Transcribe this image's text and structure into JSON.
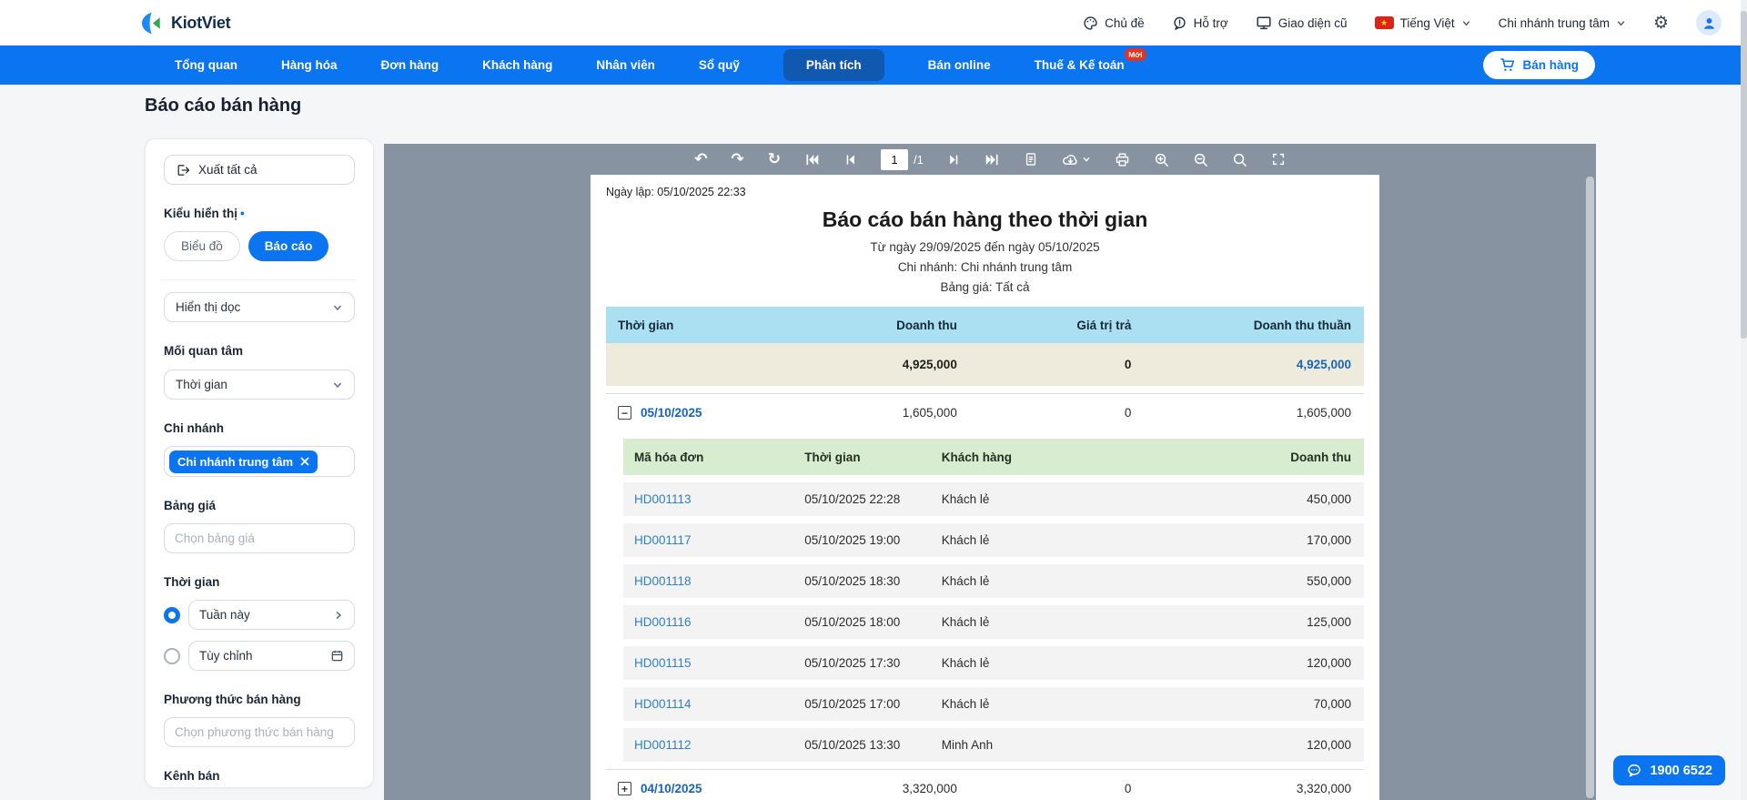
{
  "header": {
    "brand": "KiotViet",
    "theme": "Chủ đề",
    "support": "Hỗ trợ",
    "old_ui": "Giao diện cũ",
    "language": "Tiếng Việt",
    "branch": "Chi nhánh trung tâm"
  },
  "nav": {
    "items": [
      {
        "label": "Tổng quan"
      },
      {
        "label": "Hàng hóa"
      },
      {
        "label": "Đơn hàng"
      },
      {
        "label": "Khách hàng"
      },
      {
        "label": "Nhân viên"
      },
      {
        "label": "Sổ quỹ"
      },
      {
        "label": "Phân tích"
      },
      {
        "label": "Bán online"
      },
      {
        "label": "Thuế & Kế toán"
      }
    ],
    "new_badge": "Mới",
    "sell_button": "Bán hàng"
  },
  "page": {
    "title": "Báo cáo bán hàng"
  },
  "filters": {
    "export": "Xuất tất cả",
    "display_label": "Kiểu hiển thị",
    "display_dot": "•",
    "chart_option": "Biểu đồ",
    "report_option": "Báo cáo",
    "orientation_value": "Hiển thị dọc",
    "concern_label": "Mối quan tâm",
    "concern_value": "Thời gian",
    "branch_label": "Chi nhánh",
    "branch_tag": "Chi nhánh trung tâm",
    "pricebook_label": "Bảng giá",
    "pricebook_placeholder": "Chọn bảng giá",
    "time_label": "Thời gian",
    "time_preset": "Tuần này",
    "time_custom": "Tùy chỉnh",
    "method_label": "Phương thức bán hàng",
    "method_placeholder": "Chọn phương thức bán hàng",
    "channel_label": "Kênh bán"
  },
  "viewer": {
    "page_current": "1",
    "page_total": "/1",
    "report": {
      "created": "Ngày lập: 05/10/2025 22:33",
      "title": "Báo cáo bán hàng theo thời gian",
      "range": "Từ ngày 29/09/2025 đến ngày 05/10/2025",
      "branch": "Chi nhánh: Chi nhánh trung tâm",
      "pricebook": "Bảng giá: Tất cả"
    }
  },
  "table": {
    "headers": [
      "Thời gian",
      "Doanh thu",
      "Giá trị trả",
      "Doanh thu thuần"
    ],
    "summary": {
      "revenue": "4,925,000",
      "returns": "0",
      "net": "4,925,000"
    },
    "groups": [
      {
        "date": "05/10/2025",
        "expand_symbol": "−",
        "revenue": "1,605,000",
        "returns": "0",
        "net": "1,605,000",
        "detail_headers": [
          "Mã hóa đơn",
          "Thời gian",
          "Khách hàng",
          "Doanh thu"
        ],
        "invoices": [
          {
            "code": "HD001113",
            "time": "05/10/2025 22:28",
            "customer": "Khách lẻ",
            "revenue": "450,000"
          },
          {
            "code": "HD001117",
            "time": "05/10/2025 19:00",
            "customer": "Khách lẻ",
            "revenue": "170,000"
          },
          {
            "code": "HD001118",
            "time": "05/10/2025 18:30",
            "customer": "Khách lẻ",
            "revenue": "550,000"
          },
          {
            "code": "HD001116",
            "time": "05/10/2025 18:00",
            "customer": "Khách lẻ",
            "revenue": "125,000"
          },
          {
            "code": "HD001115",
            "time": "05/10/2025 17:30",
            "customer": "Khách lẻ",
            "revenue": "120,000"
          },
          {
            "code": "HD001114",
            "time": "05/10/2025 17:00",
            "customer": "Khách lẻ",
            "revenue": "70,000"
          },
          {
            "code": "HD001112",
            "time": "05/10/2025 13:30",
            "customer": "Minh Anh",
            "revenue": "120,000"
          }
        ]
      },
      {
        "date": "04/10/2025",
        "expand_symbol": "+",
        "revenue": "3,320,000",
        "returns": "0",
        "net": "3,320,000"
      }
    ]
  },
  "chat": {
    "phone": "1900 6522"
  },
  "colors": {
    "primary": "#0b74f0",
    "nav_active": "#1158b0",
    "table_header_bg": "#abdff2",
    "summary_row_bg": "#efebdc",
    "detail_header_bg": "#d8ecd0",
    "viewer_bg": "#8793a0",
    "link": "#2e7fc7",
    "date_link": "#1565c0",
    "badge_red": "#e8321f"
  }
}
